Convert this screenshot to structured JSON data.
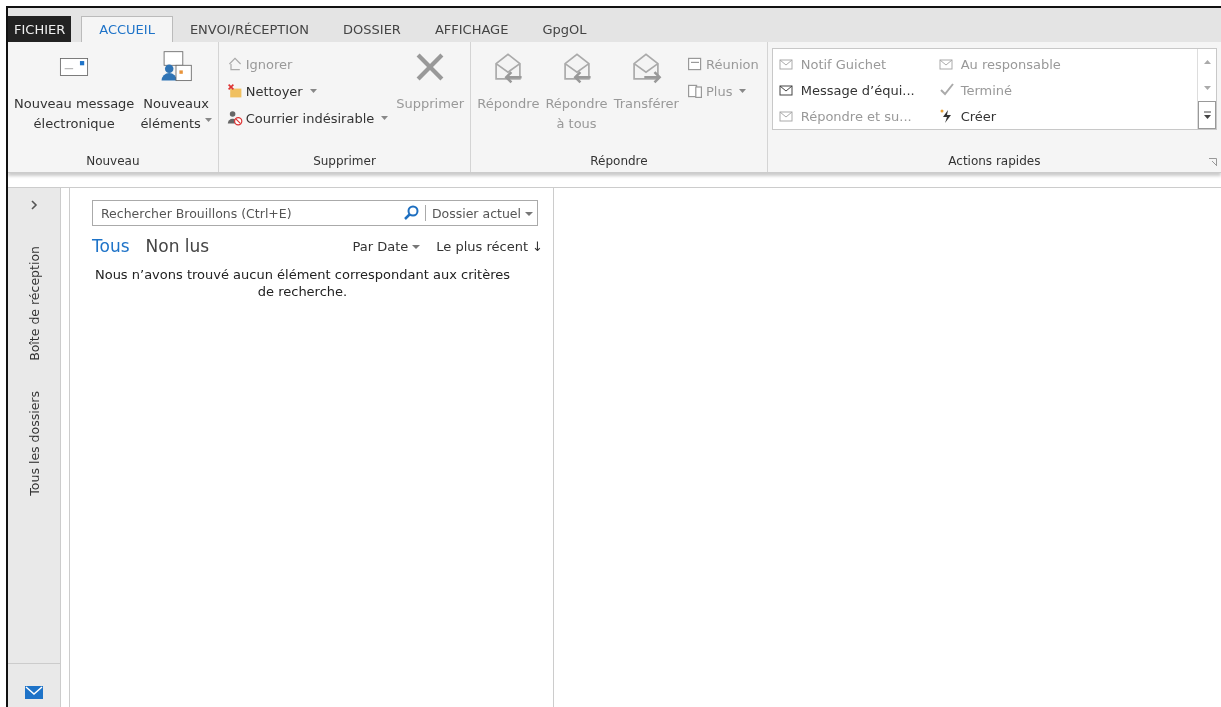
{
  "tabs": [
    {
      "label": "FICHIER",
      "kind": "file",
      "selected": false
    },
    {
      "label": "ACCUEIL",
      "kind": "tab",
      "selected": true
    },
    {
      "label": "ENVOI/RÉCEPTION",
      "kind": "tab",
      "selected": false
    },
    {
      "label": "DOSSIER",
      "kind": "tab",
      "selected": false
    },
    {
      "label": "AFFICHAGE",
      "kind": "tab",
      "selected": false
    },
    {
      "label": "GpgOL",
      "kind": "tab",
      "selected": false
    }
  ],
  "ribbon": {
    "groups": [
      {
        "label": "Nouveau",
        "items": [
          {
            "kind": "large",
            "lines": [
              "Nouveau message",
              "électronique"
            ],
            "dropdown": false,
            "disabled": false
          },
          {
            "kind": "large",
            "lines": [
              "Nouveaux",
              "éléments"
            ],
            "dropdown": true,
            "disabled": false
          }
        ]
      },
      {
        "label": "Supprimer",
        "items": [
          {
            "kind": "small",
            "lines": [
              "Ignorer"
            ],
            "dropdown": false,
            "disabled": true
          },
          {
            "kind": "small",
            "lines": [
              "Nettoyer"
            ],
            "dropdown": true,
            "disabled": false
          },
          {
            "kind": "small",
            "lines": [
              "Courrier indésirable"
            ],
            "dropdown": true,
            "disabled": false
          },
          {
            "kind": "large",
            "lines": [
              "Supprimer"
            ],
            "dropdown": false,
            "disabled": true
          }
        ]
      },
      {
        "label": "Répondre",
        "items": [
          {
            "kind": "large",
            "lines": [
              "Répondre"
            ],
            "dropdown": false,
            "disabled": true
          },
          {
            "kind": "large",
            "lines": [
              "Répondre",
              "à tous"
            ],
            "dropdown": false,
            "disabled": true
          },
          {
            "kind": "large",
            "lines": [
              "Transférer"
            ],
            "dropdown": false,
            "disabled": true
          },
          {
            "kind": "small",
            "lines": [
              "Réunion"
            ],
            "dropdown": false,
            "disabled": true
          },
          {
            "kind": "small",
            "lines": [
              "Plus"
            ],
            "dropdown": true,
            "disabled": true
          }
        ]
      },
      {
        "label": "Actions rapides",
        "kind": "gallery",
        "items": [
          {
            "label": "Notif Guichet",
            "disabled": true
          },
          {
            "label": "Au responsable",
            "disabled": true
          },
          {
            "label": "Message d’équi...",
            "disabled": false
          },
          {
            "label": "Terminé",
            "disabled": true
          },
          {
            "label": "Répondre et su...",
            "disabled": true
          },
          {
            "label": "Créer",
            "disabled": false
          }
        ]
      }
    ]
  },
  "nav": {
    "items": [
      "Boîte de réception",
      "Tous les dossiers"
    ]
  },
  "list": {
    "search": {
      "placeholder": "Rechercher Brouillons (Ctrl+E)",
      "scope": "Dossier actuel"
    },
    "filters": [
      {
        "label": "Tous",
        "selected": true
      },
      {
        "label": "Non lus",
        "selected": false
      }
    ],
    "sort": "Par Date",
    "order": "Le plus récent ↓",
    "empty": "Nous n’avons trouvé aucun élément correspondant aux critères de recherche."
  }
}
